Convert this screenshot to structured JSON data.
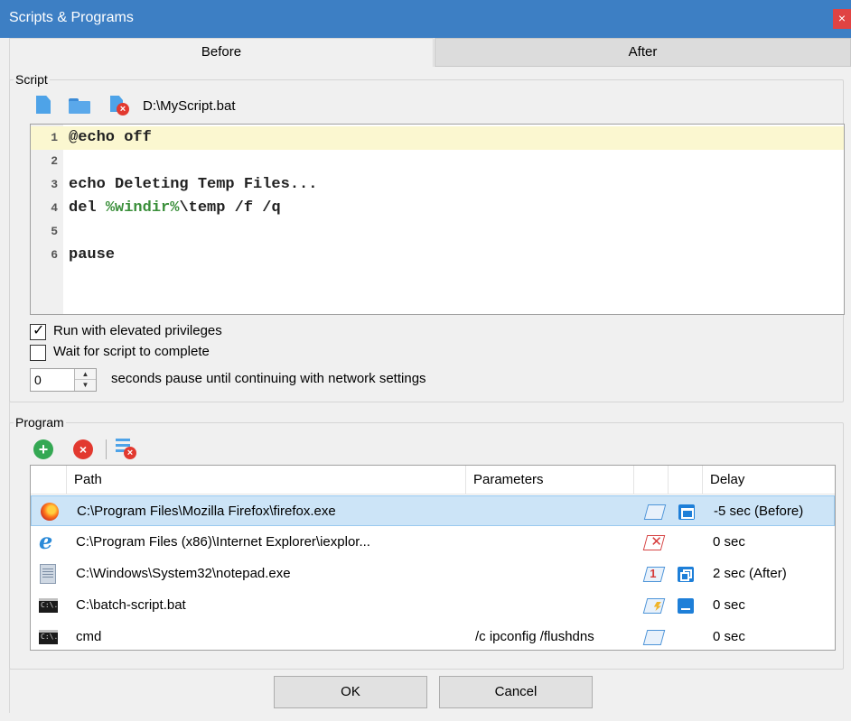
{
  "window": {
    "title": "Scripts & Programs",
    "close_glyph": "×"
  },
  "tabs": [
    {
      "label": "Before",
      "active": true
    },
    {
      "label": "After",
      "active": false
    }
  ],
  "script": {
    "group_label": "Script",
    "toolbar_icons": [
      "new-file-icon",
      "open-folder-icon",
      "delete-file-icon"
    ],
    "path": "D:\\MyScript.bat",
    "lines": [
      {
        "num": "1",
        "parts": [
          {
            "text": "@echo off"
          }
        ]
      },
      {
        "num": "2",
        "parts": [
          {
            "text": ""
          }
        ]
      },
      {
        "num": "3",
        "parts": [
          {
            "text": "echo Deleting Temp Files..."
          }
        ]
      },
      {
        "num": "4",
        "parts": [
          {
            "text": "del "
          },
          {
            "text": "%windir%",
            "var": true
          },
          {
            "text": "\\temp /f /q"
          }
        ]
      },
      {
        "num": "5",
        "parts": [
          {
            "text": ""
          }
        ]
      },
      {
        "num": "6",
        "parts": [
          {
            "text": "pause"
          }
        ]
      }
    ],
    "run_elevated": {
      "label": "Run with elevated privileges",
      "checked": true
    },
    "wait_complete": {
      "label": "Wait for script to complete",
      "checked": false
    },
    "pause_seconds": {
      "value": "0",
      "label": "seconds pause until continuing with network settings"
    },
    "check_glyph": "✓",
    "spin_up_glyph": "▲",
    "spin_down_glyph": "▼"
  },
  "program": {
    "group_label": "Program",
    "toolbar": {
      "add_glyph": "+",
      "remove_glyph": "×",
      "badge_glyph": "×"
    },
    "columns": {
      "path": "Path",
      "parameters": "Parameters",
      "delay": "Delay"
    },
    "rows": [
      {
        "icon": "firefox-icon",
        "path": "C:\\Program Files\\Mozilla Firefox\\firefox.exe",
        "parameters": "",
        "window_icon": "window-blank-icon",
        "window_mark": "",
        "state_icon": "window-normal-icon",
        "state": "normal",
        "delay": "-5 sec (Before)",
        "selected": true
      },
      {
        "icon": "internet-explorer-icon",
        "path": "C:\\Program Files (x86)\\Internet Explorer\\iexplor...",
        "parameters": "",
        "window_icon": "window-close-icon",
        "window_mark": "✕",
        "state_icon": "",
        "state": "",
        "delay": "0 sec",
        "selected": false
      },
      {
        "icon": "notepad-icon",
        "path": "C:\\Windows\\System32\\notepad.exe",
        "parameters": "",
        "window_icon": "window-one-icon",
        "window_mark": "1",
        "state_icon": "window-maximized-icon",
        "state": "max",
        "delay": "2 sec (After)",
        "selected": false
      },
      {
        "icon": "console-icon",
        "path": "C:\\batch-script.bat",
        "parameters": "",
        "window_icon": "window-bolt-icon",
        "window_mark": "",
        "state_icon": "window-minimized-icon",
        "state": "min",
        "delay": "0 sec",
        "selected": false
      },
      {
        "icon": "console-icon",
        "path": "cmd",
        "parameters": "/c ipconfig /flushdns",
        "window_icon": "window-blank-icon",
        "window_mark": "",
        "state_icon": "",
        "state": "",
        "delay": "0 sec",
        "selected": false
      }
    ],
    "console_glyph": "C:\\."
  },
  "buttons": {
    "ok": "OK",
    "cancel": "Cancel"
  },
  "colors": {
    "titlebar": "#3d7fc4",
    "close": "#e04343",
    "selected_row": "#cce4f7",
    "variable_text": "#3a8f3a",
    "current_line": "#fbf7d0"
  }
}
